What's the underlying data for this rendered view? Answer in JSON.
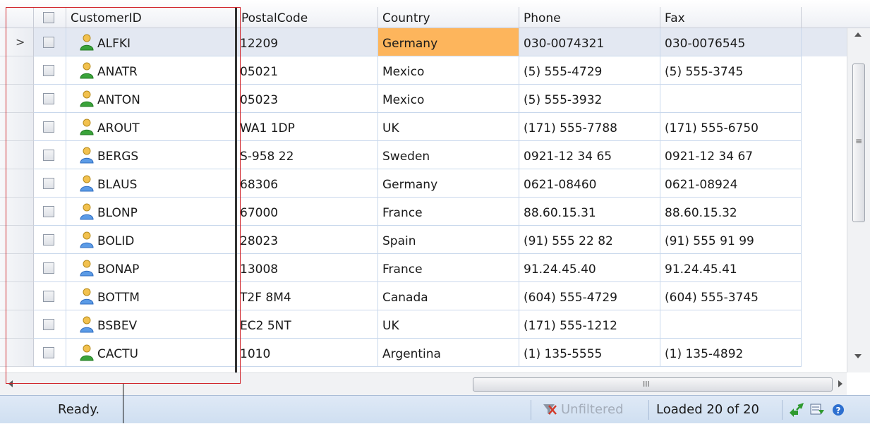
{
  "columns": {
    "customer_id": "CustomerID",
    "postal_code": "PostalCode",
    "country": "Country",
    "phone": "Phone",
    "fax": "Fax"
  },
  "rows": [
    {
      "id": "ALFKI",
      "postal": "12209",
      "country": "Germany",
      "phone": "030-0074321",
      "fax": "030-0076545",
      "icon": "user-icon-green"
    },
    {
      "id": "ANATR",
      "postal": "05021",
      "country": "Mexico",
      "phone": "(5) 555-4729",
      "fax": "(5) 555-3745",
      "icon": "user-icon-green"
    },
    {
      "id": "ANTON",
      "postal": "05023",
      "country": "Mexico",
      "phone": "(5) 555-3932",
      "fax": "",
      "icon": "user-icon-green"
    },
    {
      "id": "AROUT",
      "postal": "WA1 1DP",
      "country": "UK",
      "phone": "(171) 555-7788",
      "fax": "(171) 555-6750",
      "icon": "user-icon-green"
    },
    {
      "id": "BERGS",
      "postal": "S-958 22",
      "country": "Sweden",
      "phone": "0921-12 34 65",
      "fax": "0921-12 34 67",
      "icon": "user-icon-blue"
    },
    {
      "id": "BLAUS",
      "postal": "68306",
      "country": "Germany",
      "phone": "0621-08460",
      "fax": "0621-08924",
      "icon": "user-icon-blue"
    },
    {
      "id": "BLONP",
      "postal": "67000",
      "country": "France",
      "phone": "88.60.15.31",
      "fax": "88.60.15.32",
      "icon": "user-icon-blue"
    },
    {
      "id": "BOLID",
      "postal": "28023",
      "country": "Spain",
      "phone": "(91) 555 22 82",
      "fax": "(91) 555 91 99",
      "icon": "user-icon-blue"
    },
    {
      "id": "BONAP",
      "postal": "13008",
      "country": "France",
      "phone": "91.24.45.40",
      "fax": "91.24.45.41",
      "icon": "user-icon-blue"
    },
    {
      "id": "BOTTM",
      "postal": "T2F 8M4",
      "country": "Canada",
      "phone": "(604) 555-4729",
      "fax": "(604) 555-3745",
      "icon": "user-icon-blue"
    },
    {
      "id": "BSBEV",
      "postal": "EC2 5NT",
      "country": "UK",
      "phone": "(171) 555-1212",
      "fax": "",
      "icon": "user-icon-blue"
    },
    {
      "id": "CACTU",
      "postal": "1010",
      "country": "Argentina",
      "phone": "(1) 135-5555",
      "fax": "(1) 135-4892",
      "icon": "user-icon-green"
    }
  ],
  "current_row_marker": ">",
  "status": {
    "ready": "Ready.",
    "unfiltered": "Unfiltered",
    "loaded": "Loaded 20 of 20"
  },
  "scrollbar": {
    "hscroll_grip": "III",
    "vscroll_grip": "≡"
  },
  "colors": {
    "highlight": "#fdb55c",
    "selected_row": "#e3e8f2",
    "grid_line": "#c9d8ec",
    "annotation": "#d0242a",
    "status_bar": "#d6e4f5"
  }
}
